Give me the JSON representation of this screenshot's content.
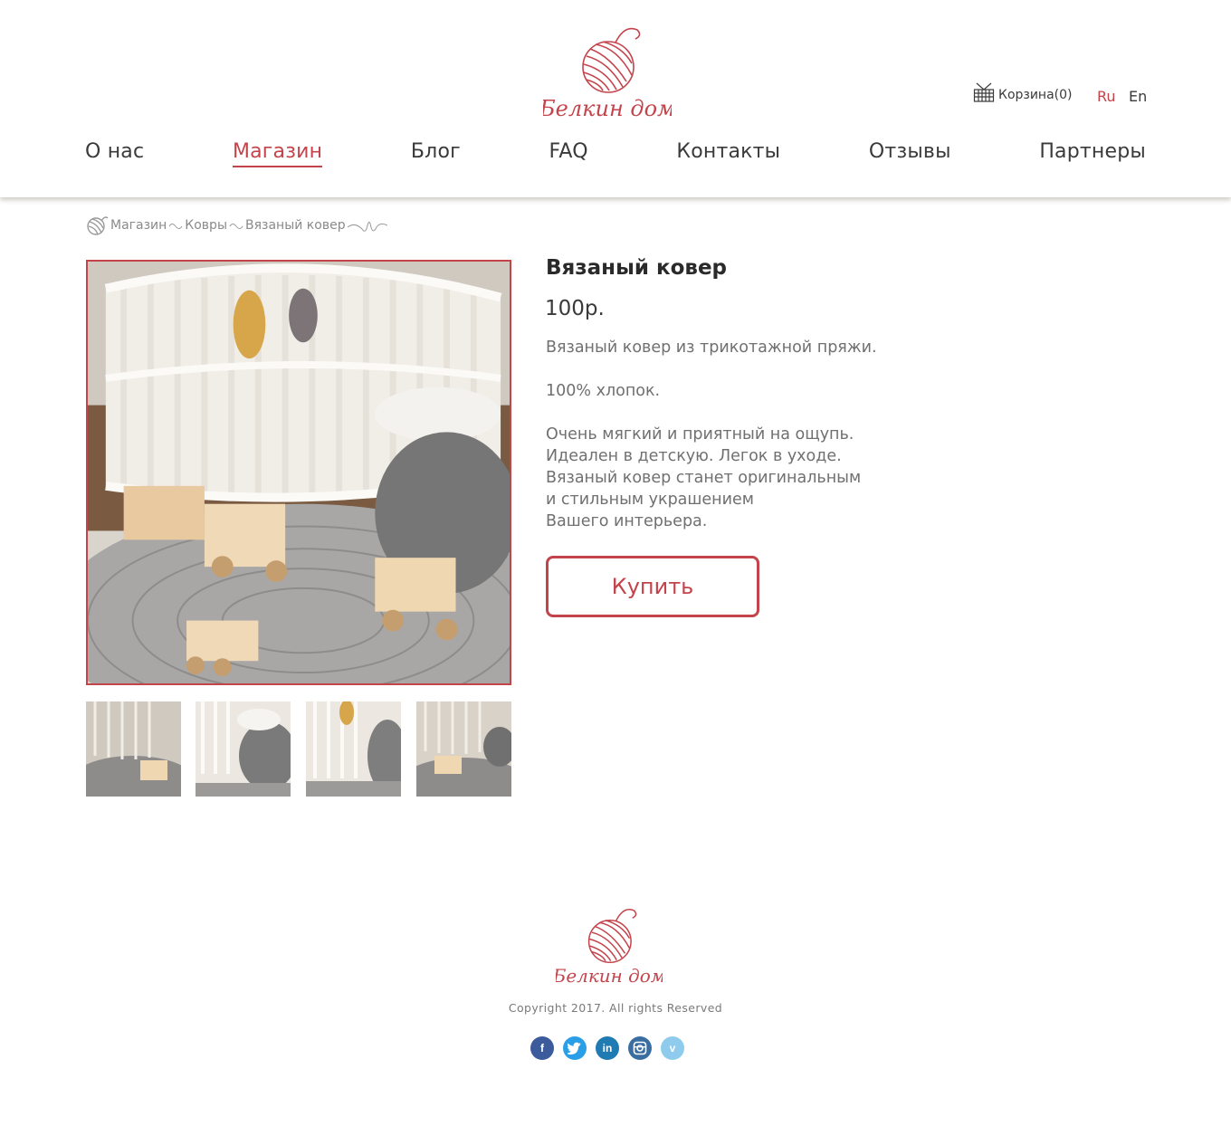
{
  "brand": {
    "name": "Белкин дом"
  },
  "header": {
    "cart_label": "Корзина(0)",
    "lang_ru": "Ru",
    "lang_en": "En"
  },
  "nav": [
    {
      "label": "О нас",
      "active": false
    },
    {
      "label": "Магазин",
      "active": true
    },
    {
      "label": "Блог",
      "active": false
    },
    {
      "label": "FAQ",
      "active": false
    },
    {
      "label": "Контакты",
      "active": false
    },
    {
      "label": "Отзывы",
      "active": false
    },
    {
      "label": "Партнеры",
      "active": false
    }
  ],
  "breadcrumb": [
    "Магазин",
    "Ковры",
    "Вязаный ковер"
  ],
  "product": {
    "title": "Вязаный ковер",
    "price": "100р.",
    "description": [
      "Вязаный ковер из трикотажной пряжи.",
      "100% хлопок.",
      "Очень мягкий и приятный на ощупь.",
      "Идеален в детскую. Легок в уходе.",
      "Вязаный ковер станет оригинальным",
      "и стильным украшением",
      "Вашего интерьера."
    ],
    "buy_label": "Купить"
  },
  "footer": {
    "copyright": "Copyright 2017. All rights Reserved",
    "socials": [
      "facebook-icon",
      "twitter-icon",
      "linkedin-icon",
      "instagram-icon",
      "vimeo-icon"
    ]
  },
  "colors": {
    "accent": "#c4444c",
    "text": "#3a3a3a",
    "muted": "#707070"
  }
}
